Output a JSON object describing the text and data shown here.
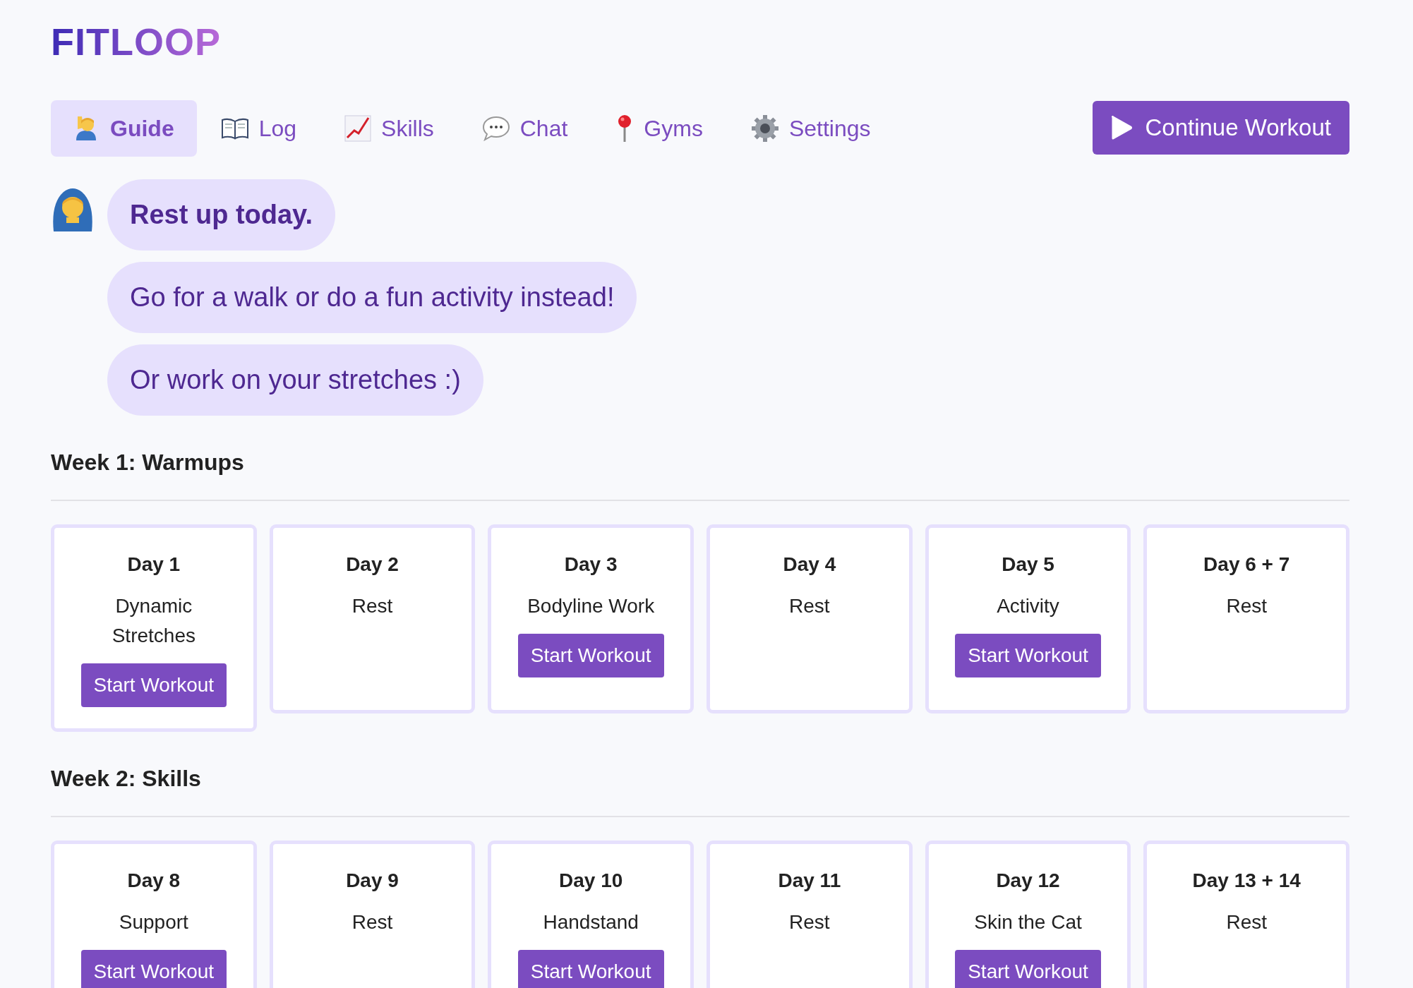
{
  "logo": "FITLOOP",
  "tabs": [
    {
      "label": "Guide",
      "selected": true
    },
    {
      "label": "Log",
      "selected": false
    },
    {
      "label": "Skills",
      "selected": false
    },
    {
      "label": "Chat",
      "selected": false
    },
    {
      "label": "Gyms",
      "selected": false
    },
    {
      "label": "Settings",
      "selected": false
    }
  ],
  "continue_button": "Continue Workout",
  "messages": [
    {
      "text": "Rest up today.",
      "kind": "headline"
    },
    {
      "text": "Go for a walk or do a fun activity instead!",
      "kind": "plain"
    },
    {
      "text": "Or work on your stretches :)",
      "kind": "plain"
    }
  ],
  "weeks": [
    {
      "title": "Week 1: Warmups",
      "days": [
        {
          "day": "Day 1",
          "activity": "Dynamic Stretches",
          "button": "Start Workout"
        },
        {
          "day": "Day 2",
          "activity": "Rest"
        },
        {
          "day": "Day 3",
          "activity": "Bodyline Work",
          "button": "Start Workout"
        },
        {
          "day": "Day 4",
          "activity": "Rest"
        },
        {
          "day": "Day 5",
          "activity": "Activity",
          "button": "Start Workout"
        },
        {
          "day": "Day 6 + 7",
          "activity": "Rest"
        }
      ]
    },
    {
      "title": "Week 2: Skills",
      "days": [
        {
          "day": "Day 8",
          "activity": "Support",
          "button": "Start Workout"
        },
        {
          "day": "Day 9",
          "activity": "Rest"
        },
        {
          "day": "Day 10",
          "activity": "Handstand",
          "button": "Start Workout"
        },
        {
          "day": "Day 11",
          "activity": "Rest"
        },
        {
          "day": "Day 12",
          "activity": "Skin the Cat",
          "button": "Start Workout"
        },
        {
          "day": "Day 13 + 14",
          "activity": "Rest"
        }
      ]
    }
  ]
}
